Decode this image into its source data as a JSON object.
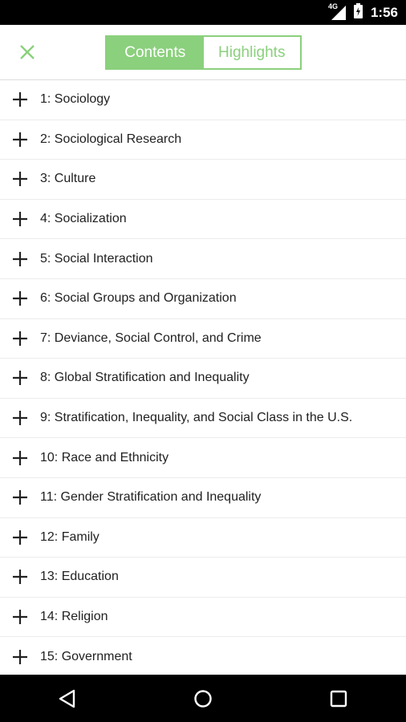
{
  "status_bar": {
    "network": "4G",
    "time": "1:56",
    "icons": [
      "signal-icon",
      "battery-icon"
    ]
  },
  "toolbar": {
    "close_icon": "close-icon",
    "tabs": [
      {
        "label": "Contents",
        "active": true
      },
      {
        "label": "Highlights",
        "active": false
      }
    ]
  },
  "chapters": [
    "1: Sociology",
    "2: Sociological Research",
    "3: Culture",
    "4: Socialization",
    "5: Social Interaction",
    "6: Social Groups and Organization",
    "7: Deviance, Social Control, and Crime",
    "8: Global Stratification and Inequality",
    "9: Stratification, Inequality, and Social Class in the U.S.",
    "10: Race and Ethnicity",
    "11: Gender Stratification and Inequality",
    "12: Family",
    "13: Education",
    "14: Religion",
    "15: Government"
  ],
  "nav_bar": {
    "icons": [
      "back-icon",
      "home-icon",
      "recents-icon"
    ]
  },
  "colors": {
    "accent": "#8bd07d",
    "status_bar": "#000000",
    "text": "#212121"
  }
}
